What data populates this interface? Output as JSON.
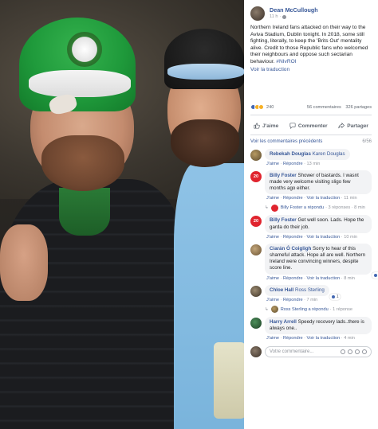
{
  "post": {
    "author": "Dean McCullough",
    "time": "11 h",
    "text": "Northern Ireland fans attacked on their way to the Aviva Stadium, Dublin tonight. In 2018, some still fighting, literally, to keep the 'Brits Out' mentality alive. Credit to those Republic fans who welcomed their neighbours and oppose such sectarian behaviour.",
    "hashtag": "#NIvROI",
    "translate": "Voir la traduction"
  },
  "stats": {
    "reaction_count": "240",
    "comments": "56 commentaires",
    "shares": "326 partages"
  },
  "actions": {
    "like": "J'aime",
    "comment": "Commenter",
    "share": "Partager"
  },
  "comments_header": {
    "previous": "Voir les commentaires précédents",
    "count": "6/56"
  },
  "comments": [
    {
      "name": "Rebekah Douglas",
      "tag": "Karen Douglas",
      "text": "",
      "like": "J'aime",
      "reply": "Répondre",
      "time": "13 min"
    },
    {
      "avatar": "20",
      "name": "Billy Foster",
      "text": "Shower of bastards. I wasnt made very welcome visiting sligo few months ago either.",
      "like": "J'aime",
      "reply": "Répondre",
      "translate": "Voir la traduction",
      "time": "11 min",
      "replies_label": "Billy Foster a répondu",
      "replies_meta": "· 3 réponses · 8 min"
    },
    {
      "avatar": "20",
      "name": "Billy Foster",
      "text": "Get well soon. Lads. Hope the garda do their job.",
      "like": "J'aime",
      "reply": "Répondre",
      "translate": "Voir la traduction",
      "time": "10 min"
    },
    {
      "name": "Ciarán Ó Coigligh",
      "text": "Sorry to hear of this shameful attack. Hope all are well. Northern Ireland were convincing winners, despite score line.",
      "like": "J'aime",
      "reply": "Répondre",
      "translate": "Voir la traduction",
      "time": "8 min",
      "reaction_count": "2"
    },
    {
      "name": "Chloe Hall",
      "tag": "Ross Sterling",
      "text": "",
      "like": "J'aime",
      "reply": "Répondre",
      "time": "7 min",
      "reaction_count": "1",
      "replies_label": "Ross Sterling a répondu",
      "replies_meta": "· 1 réponse"
    },
    {
      "name": "Harry Arrell",
      "text": "Speedy recovery lads..there is always one..",
      "like": "J'aime",
      "reply": "Répondre",
      "translate": "Voir la traduction",
      "time": "4 min"
    }
  ],
  "composer": {
    "placeholder": "Votre commentaire..."
  },
  "icons": {
    "like": "thumbs-up-icon",
    "comment": "speech-bubble-icon",
    "share": "share-arrow-icon",
    "globe": "globe-icon",
    "emoji": "emoji-icon",
    "camera": "camera-icon",
    "gif": "gif-icon",
    "sticker": "sticker-icon"
  },
  "colors": {
    "link": "#385898",
    "meta": "#90949c",
    "bubble": "#f2f3f5",
    "like_blue": "#4267b2"
  }
}
